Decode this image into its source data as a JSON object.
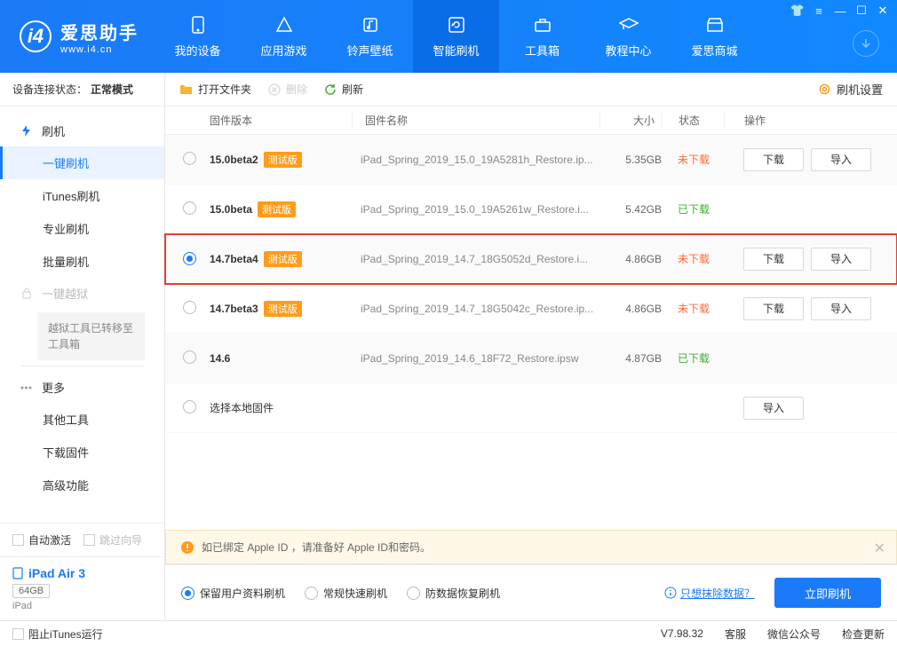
{
  "brand": {
    "name": "爱思助手",
    "url": "www.i4.cn"
  },
  "nav": {
    "mydevice": "我的设备",
    "appgames": "应用游戏",
    "ringtones": "铃声壁纸",
    "smartflash": "智能刷机",
    "toolbox": "工具箱",
    "tutorials": "教程中心",
    "store": "爱思商城"
  },
  "sidebar": {
    "conn_label": "设备连接状态：",
    "conn_mode": "正常模式",
    "flash_group": "刷机",
    "items": {
      "oneclick": "一键刷机",
      "itunes": "iTunes刷机",
      "pro": "专业刷机",
      "batch": "批量刷机"
    },
    "jailbreak_group": "一键越狱",
    "jailbreak_notice": "越狱工具已转移至工具箱",
    "more_group": "更多",
    "more": {
      "other_tools": "其他工具",
      "download_fw": "下载固件",
      "advanced": "高级功能"
    },
    "auto_activate": "自动激活",
    "skip_guide": "跳过向导",
    "device_name": "iPad Air 3",
    "device_storage": "64GB",
    "device_model": "iPad"
  },
  "toolbar": {
    "open_folder": "打开文件夹",
    "delete": "删除",
    "refresh": "刷新",
    "settings": "刷机设置"
  },
  "table": {
    "header": {
      "version": "固件版本",
      "name": "固件名称",
      "size": "大小",
      "status": "状态",
      "action": "操作"
    },
    "beta_label": "测试版",
    "download_btn": "下载",
    "import_btn": "导入",
    "rows": [
      {
        "version": "15.0beta2",
        "beta": true,
        "name": "iPad_Spring_2019_15.0_19A5281h_Restore.ip...",
        "size": "5.35GB",
        "status": "未下载",
        "status_cls": "pending",
        "actions": true,
        "selected": false
      },
      {
        "version": "15.0beta",
        "beta": true,
        "name": "iPad_Spring_2019_15.0_19A5261w_Restore.i...",
        "size": "5.42GB",
        "status": "已下载",
        "status_cls": "done",
        "actions": false,
        "selected": false
      },
      {
        "version": "14.7beta4",
        "beta": true,
        "name": "iPad_Spring_2019_14.7_18G5052d_Restore.i...",
        "size": "4.86GB",
        "status": "未下载",
        "status_cls": "pending",
        "actions": true,
        "selected": true,
        "highlight": true
      },
      {
        "version": "14.7beta3",
        "beta": true,
        "name": "iPad_Spring_2019_14.7_18G5042c_Restore.ip...",
        "size": "4.86GB",
        "status": "未下载",
        "status_cls": "pending",
        "actions": true,
        "selected": false
      },
      {
        "version": "14.6",
        "beta": false,
        "name": "iPad_Spring_2019_14.6_18F72_Restore.ipsw",
        "size": "4.87GB",
        "status": "已下载",
        "status_cls": "done",
        "actions": false,
        "selected": false
      }
    ],
    "local_row": "选择本地固件"
  },
  "warn": "如已绑定 Apple ID ，请准备好 Apple ID和密码。",
  "options": {
    "keep_data": "保留用户资料刷机",
    "normal": "常规快速刷机",
    "restore": "防数据恢复刷机",
    "wipe_link": "只想抹除数据？",
    "flash_now": "立即刷机"
  },
  "footer": {
    "block_itunes": "阻止iTunes运行",
    "version": "V7.98.32",
    "service": "客服",
    "wechat": "微信公众号",
    "update": "检查更新"
  }
}
